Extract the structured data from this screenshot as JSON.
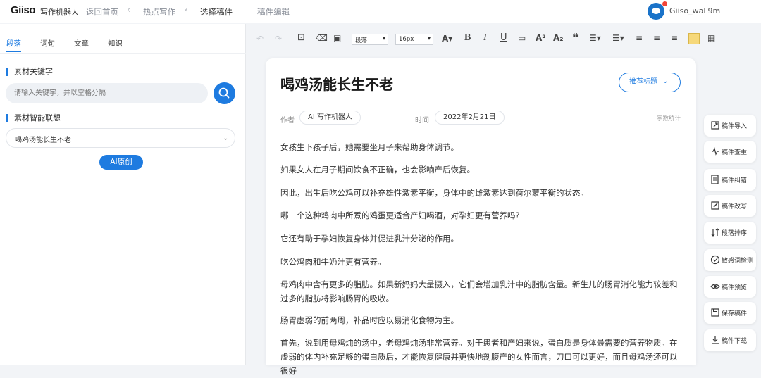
{
  "nav": {
    "logo_main": "Giiso",
    "logo_sub": "写作机器人",
    "breadcrumbs": [
      "返回首页",
      "热点写作",
      "选择稿件",
      "稿件编辑"
    ],
    "username": "Giiso_waL9m"
  },
  "left_panel": {
    "tabs": [
      "段落",
      "词句",
      "文章",
      "知识"
    ],
    "keyword_title": "素材关键字",
    "keyword_placeholder": "请输入关键字，并以空格分隔",
    "assoc_title": "素材智能联想",
    "assoc_value": "喝鸡汤能长生不老",
    "ai_button": "AI原创"
  },
  "toolbar": {
    "paragraph_format": "段落",
    "font_size": "16px"
  },
  "document": {
    "title": "喝鸡汤能长生不老",
    "recommend_button": "推荐标题",
    "author_label": "作者",
    "author_value": "AI 写作机器人",
    "time_label": "时间",
    "time_value": "2022年2月21日",
    "wordcount_label": "字数统计",
    "paragraphs": [
      "女孩生下孩子后，她需要坐月子来帮助身体调节。",
      "如果女人在月子期间饮食不正确，也会影响产后恢复。",
      "因此，出生后吃公鸡可以补充雄性激素平衡，身体中的雌激素达到荷尔蒙平衡的状态。",
      "哪一个这种鸡肉中所煮的鸡蛋更适合产妇喝酒，对孕妇更有营养吗?",
      "它还有助于孕妇恢复身体并促进乳汁分泌的作用。",
      "吃公鸡肉和牛奶汁更有营养。",
      "母鸡肉中含有更多的脂肪。如果新妈妈大量摄入，它们会增加乳汁中的脂肪含量。新生儿的肠胃消化能力较差和过多的脂肪将影响肠胃的吸收。",
      "肠胃虚弱的前两周，补品时应以易消化食物为主。",
      "首先，说到用母鸡炖的汤中，老母鸡炖汤非常营养。对于患者和产妇来说，蛋白质是身体最需要的营养物质。在虚弱的体内补充足够的蛋白质后，才能恢复健康并更快地剖腹产的女性而言，刀口可以更好，而且母鸡汤还可以很好"
    ]
  },
  "actions": [
    "稿件导入",
    "稿件查重",
    "稿件纠错",
    "稿件改写",
    "段落排序",
    "敏感词检测",
    "稿件预览",
    "保存稿件",
    "稿件下载"
  ]
}
